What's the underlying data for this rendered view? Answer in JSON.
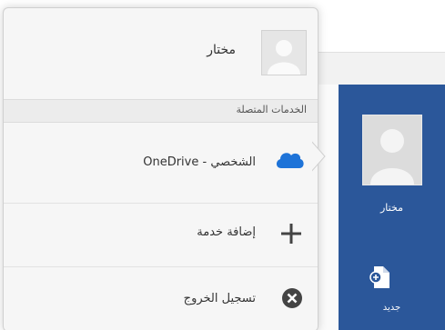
{
  "account": {
    "user_name": "مختار"
  },
  "menu": {
    "section_header": "الخدمات المتصلة",
    "onedrive_label": "الشخصي - OneDrive",
    "add_service_label": "إضافة خدمة",
    "sign_out_label": "تسجيل الخروج"
  },
  "sidebar": {
    "user_name": "مختار",
    "new_label": "جديد"
  },
  "colors": {
    "rail_background": "#2b579a",
    "onedrive_blue": "#1e73d8",
    "panel_background": "#f6f6f6"
  },
  "icons": [
    "avatar-icon",
    "onedrive-cloud-icon",
    "plus-icon",
    "sign-out-x-icon",
    "new-document-icon"
  ]
}
